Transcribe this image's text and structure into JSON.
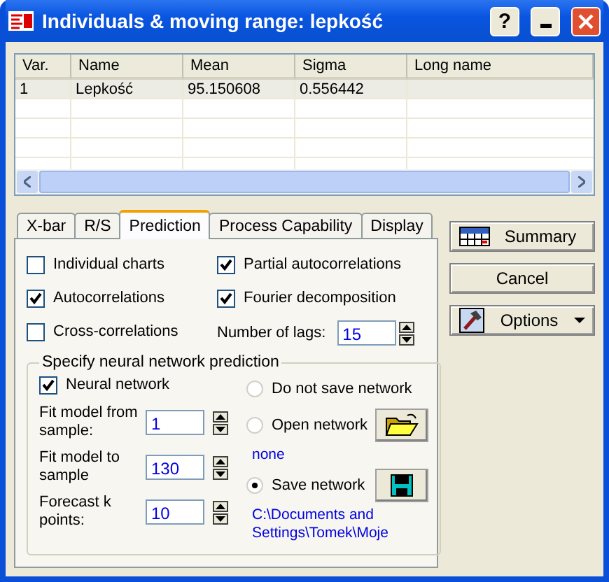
{
  "window": {
    "title": "Individuals & moving range: lepkość",
    "help": "?"
  },
  "table": {
    "columns": [
      "Var.",
      "Name",
      "Mean",
      "Sigma",
      "Long name"
    ],
    "rows": [
      {
        "cells": [
          "1",
          "Lepkość",
          "95.150608",
          "0.556442",
          ""
        ],
        "selected": true
      }
    ]
  },
  "tabs": [
    {
      "label": "X-bar",
      "selected": false
    },
    {
      "label": "R/S",
      "selected": false
    },
    {
      "label": "Prediction",
      "selected": true
    },
    {
      "label": "Process Capability",
      "selected": false
    },
    {
      "label": "Display",
      "selected": false
    }
  ],
  "left_options": [
    {
      "label": "Individual charts",
      "checked": false
    },
    {
      "label": "Autocorrelations",
      "checked": true
    },
    {
      "label": "Cross-correlations",
      "checked": false
    }
  ],
  "right_options": [
    {
      "label": "Partial autocorrelations",
      "checked": true
    },
    {
      "label": "Fourier decomposition",
      "checked": true
    }
  ],
  "lags": {
    "label": "Number of lags:",
    "value": "15"
  },
  "neural": {
    "legend": "Specify neural network prediction",
    "network": {
      "label": "Neural network",
      "checked": true
    },
    "fields": [
      {
        "label": "Fit model from sample:",
        "value": "1"
      },
      {
        "label": "Fit model to sample",
        "value": "130"
      },
      {
        "label": "Forecast k points:",
        "value": "10"
      }
    ],
    "radios": [
      {
        "label": "Do not save network",
        "selected": false
      },
      {
        "label": "Open network",
        "selected": false,
        "kind": "folder",
        "note": "none"
      },
      {
        "label": "Save network",
        "selected": true,
        "kind": "disk",
        "note": "C:\\Documents and Settings\\Tomek\\Moje"
      }
    ]
  },
  "buttons": [
    {
      "label": "Summary",
      "kind": "summary"
    },
    {
      "label": "Cancel",
      "kind": "plain"
    },
    {
      "label": "Options",
      "kind": "options"
    }
  ]
}
